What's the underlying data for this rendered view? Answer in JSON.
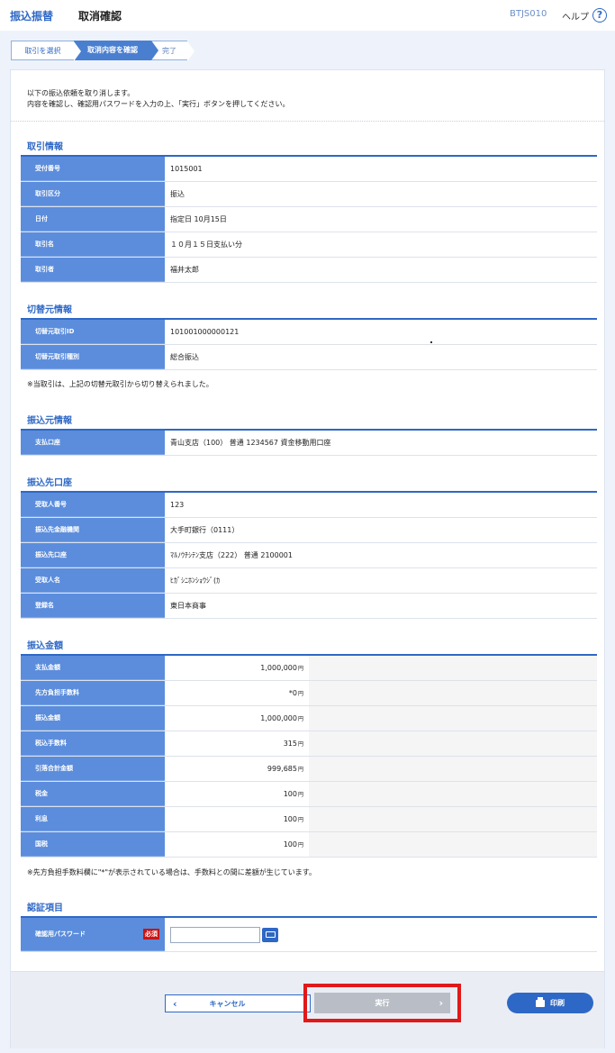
{
  "header": {
    "category": "振込振替",
    "title": "取消確認",
    "screen_code": "BTJS010",
    "help_label": "ヘルプ",
    "help_icon": "?"
  },
  "steps": [
    "取引を選択",
    "取消内容を確認",
    "完了"
  ],
  "intro": [
    "以下の振込依頼を取り消します。",
    "内容を確認し、確認用パスワードを入力の上、「実行」ボタンを押してください。"
  ],
  "transaction": {
    "title": "取引情報",
    "rows": [
      {
        "label": "受付番号",
        "value": "1015001"
      },
      {
        "label": "取引区分",
        "value": "振込"
      },
      {
        "label": "日付",
        "value": "指定日 10月15日"
      },
      {
        "label": "取引名",
        "value": "１０月１５日支払い分"
      },
      {
        "label": "取引者",
        "value": "福井太郎"
      }
    ]
  },
  "source": {
    "title": "切替元情報",
    "rows": [
      {
        "label": "切替元取引ID",
        "value": "101001000000121"
      },
      {
        "label": "切替元取引種別",
        "value": "総合振込"
      }
    ],
    "note": "※当取引は、上記の切替元取引から切り替えられました。"
  },
  "from_info": {
    "title": "振込元情報",
    "rows": [
      {
        "label": "支払口座",
        "value": "青山支店（100） 普通 1234567 資金移動用口座"
      }
    ]
  },
  "dest": {
    "title": "振込先口座",
    "rows": [
      {
        "label": "受取人番号",
        "value": "123"
      },
      {
        "label": "振込先金融機関",
        "value": "大手町銀行（0111）"
      },
      {
        "label": "振込先口座",
        "value": "ﾏﾙﾉｳﾁｼﾃﾝ支店（222） 普通 2100001"
      },
      {
        "label": "受取人名",
        "value": "ﾋｶﾞｼﾆﾎﾝｼｮｳｼﾞ(ｶ"
      },
      {
        "label": "登録名",
        "value": "東日本商事"
      }
    ]
  },
  "amount": {
    "title": "振込金額",
    "unit": "円",
    "rows": [
      {
        "label": "支払金額",
        "value": "1,000,000"
      },
      {
        "label": "先方負担手数料",
        "value": "*0"
      },
      {
        "label": "振込金額",
        "value": "1,000,000"
      },
      {
        "label": "税込手数料",
        "value": "315"
      },
      {
        "label": "引落合計金額",
        "value": "999,685"
      },
      {
        "label": "税金",
        "value": "100"
      },
      {
        "label": "利息",
        "value": "100"
      },
      {
        "label": "国税",
        "value": "100"
      }
    ],
    "note": "※先方負担手数料欄に\"*\"が表示されている場合は、手数料との間に差額が生じています。"
  },
  "auth": {
    "title": "認証項目",
    "password_label": "確認用パスワード",
    "required": "必須",
    "password_value": ""
  },
  "buttons": {
    "cancel": "キャンセル",
    "execute": "実行",
    "print": "印刷"
  }
}
